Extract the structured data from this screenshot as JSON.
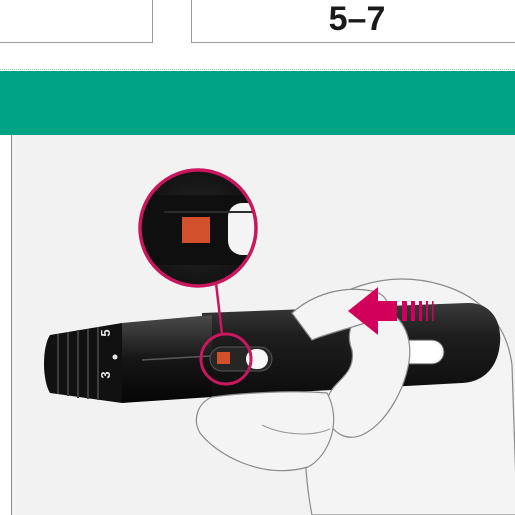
{
  "header": {
    "left_cell_text": "",
    "right_cell_text": "5–7"
  },
  "illustration": {
    "depth_dial_marks": [
      "3",
      "5"
    ],
    "colors": {
      "header_band": "#00a384",
      "arrow": "#d1005a",
      "highlight_circle": "#c8175d",
      "indicator": "#d2502c",
      "device_body": "#1b1b1b"
    }
  }
}
